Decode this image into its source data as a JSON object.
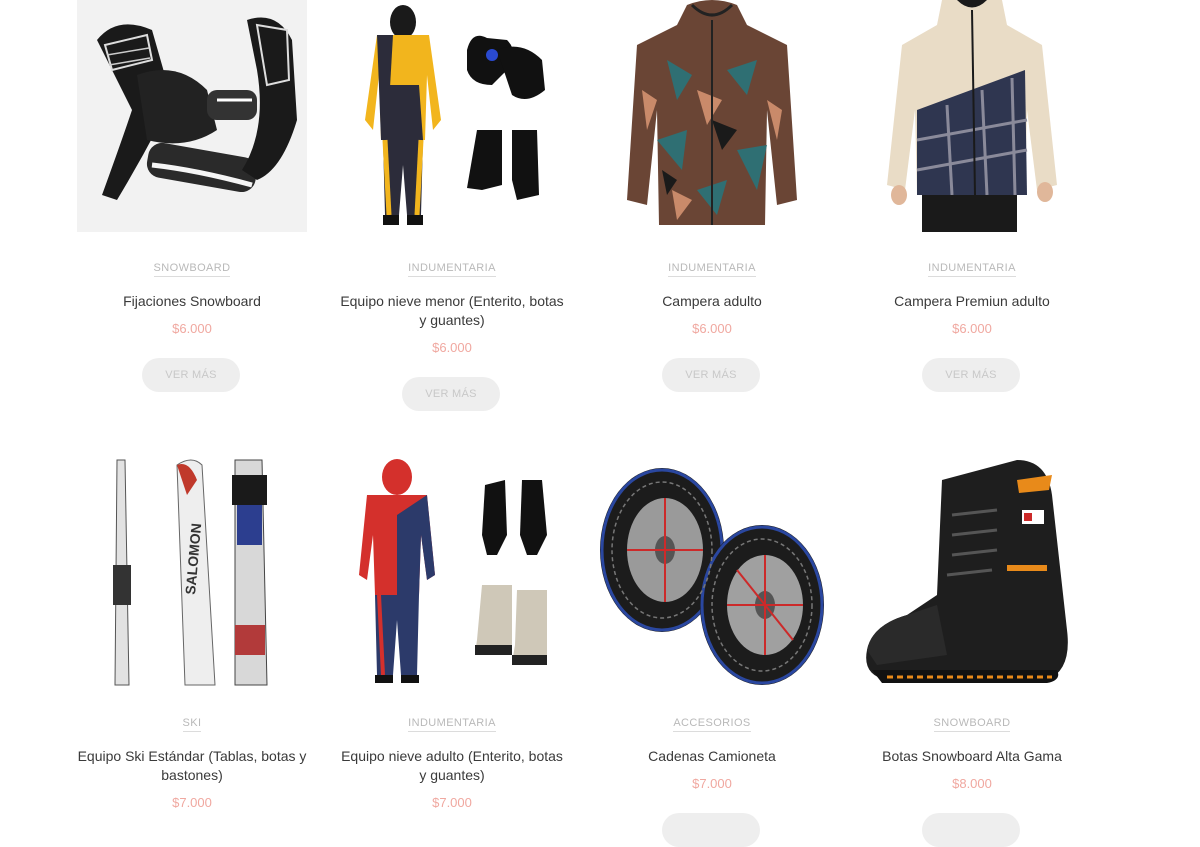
{
  "products": [
    {
      "category": "SNOWBOARD",
      "title": "Fijaciones Snowboard",
      "price": "$6.000",
      "button": "VER MÁS",
      "image_icon": "snowboard-bindings"
    },
    {
      "category": "INDUMENTARIA",
      "title": "Equipo nieve menor (Enterito, botas y guantes)",
      "price": "$6.000",
      "button": "VER MÁS",
      "image_icon": "kids-snowsuit-set"
    },
    {
      "category": "INDUMENTARIA",
      "title": "Campera adulto",
      "price": "$6.000",
      "button": "VER MÁS",
      "image_icon": "patterned-jacket"
    },
    {
      "category": "INDUMENTARIA",
      "title": "Campera Premiun adulto",
      "price": "$6.000",
      "button": "VER MÁS",
      "image_icon": "premium-jacket"
    },
    {
      "category": "SKI",
      "title": "Equipo Ski Estándar (Tablas, botas y bastones)",
      "price": "$7.000",
      "image_icon": "skis"
    },
    {
      "category": "INDUMENTARIA",
      "title": "Equipo nieve adulto (Enterito, botas y guantes)",
      "price": "$7.000",
      "image_icon": "adult-snowsuit-set"
    },
    {
      "category": "ACCESORIOS",
      "title": "Cadenas Camioneta",
      "price": "$7.000",
      "image_icon": "tire-chains"
    },
    {
      "category": "SNOWBOARD",
      "title": "Botas Snowboard Alta Gama",
      "price": "$8.000",
      "image_icon": "snowboard-boot"
    }
  ],
  "colors": {
    "price": "#f0a8a0",
    "category": "#b9b9b9",
    "title": "#3a3a3a",
    "button_bg": "#eeeeee"
  }
}
